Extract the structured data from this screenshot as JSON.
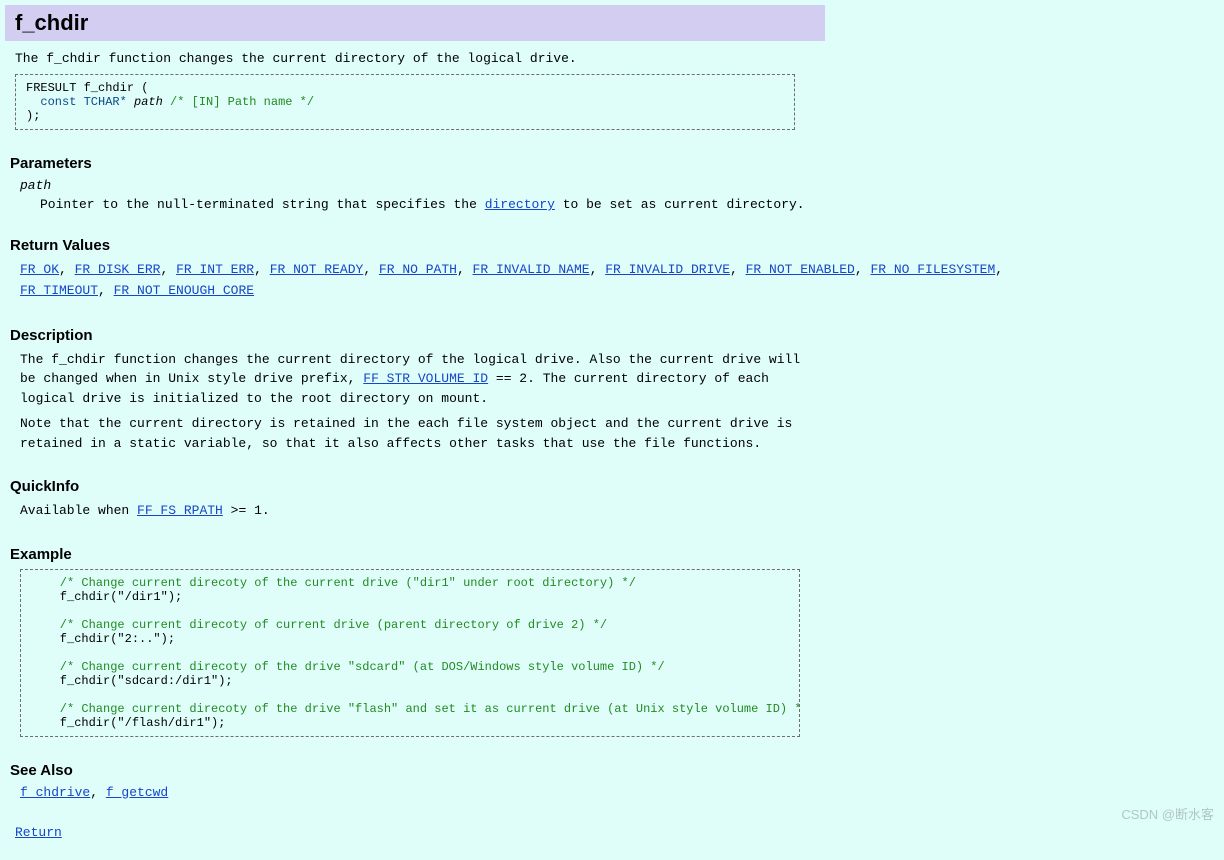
{
  "title": "f_chdir",
  "intro_prefix": "The ",
  "intro_func": "f_chdir",
  "intro_suffix": " function changes the current directory of the logical drive.",
  "syntax": {
    "line1a": "FRESULT f_chdir (",
    "line2_kw": "  const TCHAR*",
    "line2_param": " path",
    "line2_comment": " /* [IN] Path name */",
    "line3": ");"
  },
  "sections": {
    "parameters_h": "Parameters",
    "return_h": "Return Values",
    "desc_h": "Description",
    "quick_h": "QuickInfo",
    "example_h": "Example",
    "seealso_h": "See Also"
  },
  "parameters": {
    "name": "path",
    "desc_before": "Pointer to the null-terminated string that specifies the ",
    "desc_link": "directory",
    "desc_after": " to be set as current directory."
  },
  "return_values": [
    "FR_OK",
    "FR_DISK_ERR",
    "FR_INT_ERR",
    "FR_NOT_READY",
    "FR_NO_PATH",
    "FR_INVALID_NAME",
    "FR_INVALID_DRIVE",
    "FR_NOT_ENABLED",
    "FR_NO_FILESYSTEM",
    "FR_TIMEOUT",
    "FR_NOT_ENOUGH_CORE"
  ],
  "description": {
    "p1_before": "The ",
    "p1_tt": "f_chdir",
    "p1_mid": " function changes the current directory of the logical drive. Also the current drive will be changed when in Unix style drive prefix, ",
    "p1_link": "FF_STR_VOLUME_ID",
    "p1_eq": " == 2",
    "p1_after": ". The current directory of each logical drive is initialized to the root directory on mount.",
    "p2": "Note that the current directory is retained in the each file system object and the current drive is retained in a static variable, so that it also affects other tasks that use the file functions."
  },
  "quickinfo": {
    "before": "Available when ",
    "link": "FF_FS_RPATH",
    "after": " >= 1."
  },
  "example": {
    "c1": "    /* Change current direcoty of the current drive (\"dir1\" under root directory) */",
    "l1": "    f_chdir(\"/dir1\");",
    "c2": "    /* Change current direcoty of current drive (parent directory of drive 2) */",
    "l2": "    f_chdir(\"2:..\");",
    "c3": "    /* Change current direcoty of the drive \"sdcard\" (at DOS/Windows style volume ID) */",
    "l3": "    f_chdir(\"sdcard:/dir1\");",
    "c4": "    /* Change current direcoty of the drive \"flash\" and set it as current drive (at Unix style volume ID) */",
    "l4": "    f_chdir(\"/flash/dir1\");"
  },
  "see_also": [
    "f_chdrive",
    "f_getcwd"
  ],
  "return_link": "Return",
  "watermark": "CSDN @断水客"
}
